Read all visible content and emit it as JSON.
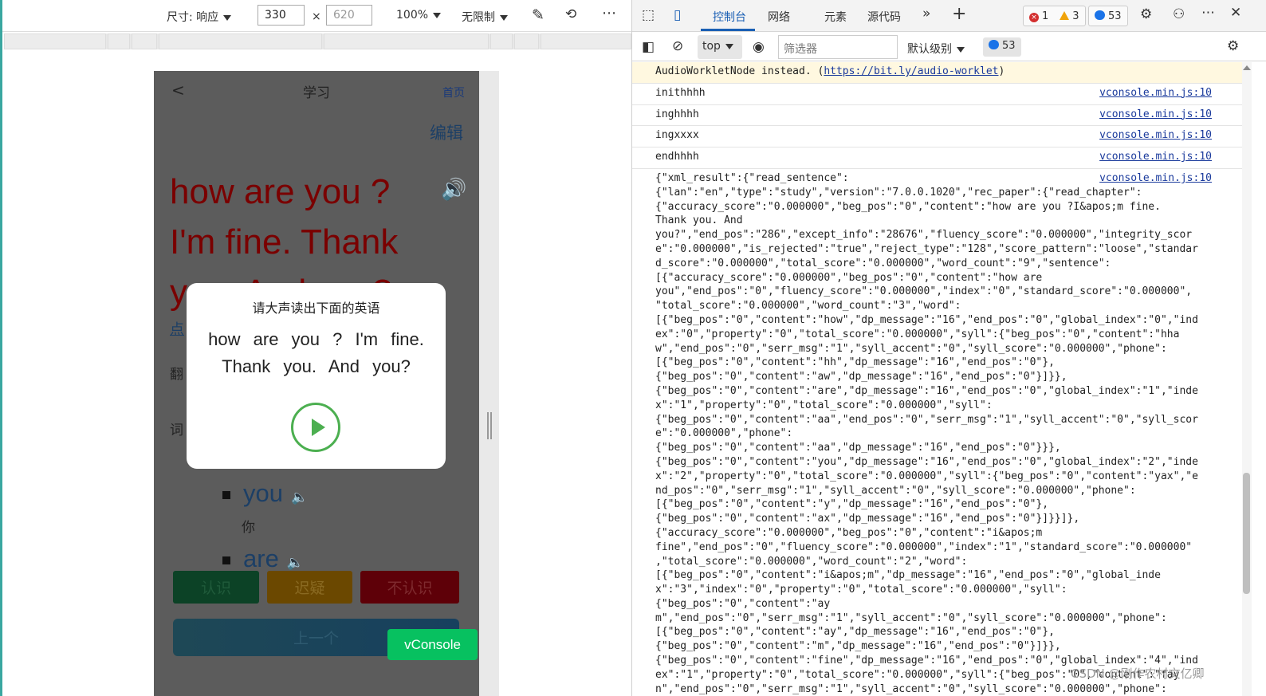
{
  "device_toolbar": {
    "dimensions_label": "尺寸: 响应",
    "width_value": "330",
    "times": "×",
    "height_placeholder": "620",
    "zoom": "100%",
    "throttle": "无限制"
  },
  "app": {
    "back": "<",
    "title": "学习",
    "home_link": "首页",
    "edit_link": "编辑",
    "sentence": "how are you ? I'm fine. Thank you. And you?",
    "hint": "点",
    "translation_label": "翻",
    "words_label": "词",
    "words": [
      {
        "word": "you",
        "meaning": "你"
      },
      {
        "word": "are",
        "meaning": ""
      }
    ],
    "buttons": {
      "know": "认识",
      "doubt": "迟疑",
      "unknown": "不认识",
      "prev": "上一个"
    },
    "vconsole": "vConsole"
  },
  "modal": {
    "title": "请大声读出下面的英语",
    "text": "how are you ? I'm fine. Thank you. And you?"
  },
  "devtools": {
    "tabs": {
      "console": "控制台",
      "network": "网络",
      "elements": "元素",
      "sources": "源代码"
    },
    "counts": {
      "errors": "1",
      "warnings": "3",
      "messages": "53"
    },
    "context": "top",
    "filter_placeholder": "筛选器",
    "level": "默认级别",
    "message_count": "53"
  },
  "console": {
    "warning_text": "AudioWorkletNode instead. (",
    "warning_link": "https://bit.ly/audio-worklet",
    "warning_end": ")",
    "logs": [
      {
        "text": "inithhhh",
        "src": "vconsole.min.js:10"
      },
      {
        "text": "inghhhh",
        "src": "vconsole.min.js:10"
      },
      {
        "text": "ingxxxx",
        "src": "vconsole.min.js:10"
      },
      {
        "text": "endhhhh",
        "src": "vconsole.min.js:10"
      },
      {
        "text": "{\"xml_result\":{\"read_sentence\":\n{\"lan\":\"en\",\"type\":\"study\",\"version\":\"7.0.0.1020\",\"rec_paper\":{\"read_chapter\":\n{\"accuracy_score\":\"0.000000\",\"beg_pos\":\"0\",\"content\":\"how are you ?I&apos;m fine.\nThank you. And\nyou?\",\"end_pos\":\"286\",\"except_info\":\"28676\",\"fluency_score\":\"0.000000\",\"integrity_score\":\"0.000000\",\"is_rejected\":\"true\",\"reject_type\":\"128\",\"score_pattern\":\"loose\",\"standard_score\":\"0.000000\",\"total_score\":\"0.000000\",\"word_count\":\"9\",\"sentence\":\n[{\"accuracy_score\":\"0.000000\",\"beg_pos\":\"0\",\"content\":\"how are\nyou\",\"end_pos\":\"0\",\"fluency_score\":\"0.000000\",\"index\":\"0\",\"standard_score\":\"0.000000\",\n\"total_score\":\"0.000000\",\"word_count\":\"3\",\"word\":\n[{\"beg_pos\":\"0\",\"content\":\"how\",\"dp_message\":\"16\",\"end_pos\":\"0\",\"global_index\":\"0\",\"index\":\"0\",\"property\":\"0\",\"total_score\":\"0.000000\",\"syll\":{\"beg_pos\":\"0\",\"content\":\"hhaw\",\"end_pos\":\"0\",\"serr_msg\":\"1\",\"syll_accent\":\"0\",\"syll_score\":\"0.000000\",\"phone\":\n[{\"beg_pos\":\"0\",\"content\":\"hh\",\"dp_message\":\"16\",\"end_pos\":\"0\"},\n{\"beg_pos\":\"0\",\"content\":\"aw\",\"dp_message\":\"16\",\"end_pos\":\"0\"}]}},\n{\"beg_pos\":\"0\",\"content\":\"are\",\"dp_message\":\"16\",\"end_pos\":\"0\",\"global_index\":\"1\",\"index\":\"1\",\"property\":\"0\",\"total_score\":\"0.000000\",\"syll\":\n{\"beg_pos\":\"0\",\"content\":\"aa\",\"end_pos\":\"0\",\"serr_msg\":\"1\",\"syll_accent\":\"0\",\"syll_score\":\"0.000000\",\"phone\":\n{\"beg_pos\":\"0\",\"content\":\"aa\",\"dp_message\":\"16\",\"end_pos\":\"0\"}}},\n{\"beg_pos\":\"0\",\"content\":\"you\",\"dp_message\":\"16\",\"end_pos\":\"0\",\"global_index\":\"2\",\"index\":\"2\",\"property\":\"0\",\"total_score\":\"0.000000\",\"syll\":{\"beg_pos\":\"0\",\"content\":\"yax\",\"end_pos\":\"0\",\"serr_msg\":\"1\",\"syll_accent\":\"0\",\"syll_score\":\"0.000000\",\"phone\":\n[{\"beg_pos\":\"0\",\"content\":\"y\",\"dp_message\":\"16\",\"end_pos\":\"0\"},\n{\"beg_pos\":\"0\",\"content\":\"ax\",\"dp_message\":\"16\",\"end_pos\":\"0\"}]}}]},\n{\"accuracy_score\":\"0.000000\",\"beg_pos\":\"0\",\"content\":\"i&apos;m\nfine\",\"end_pos\":\"0\",\"fluency_score\":\"0.000000\",\"index\":\"1\",\"standard_score\":\"0.000000\"\n,\"total_score\":\"0.000000\",\"word_count\":\"2\",\"word\":\n[{\"beg_pos\":\"0\",\"content\":\"i&apos;m\",\"dp_message\":\"16\",\"end_pos\":\"0\",\"global_index\":\"3\",\"index\":\"0\",\"property\":\"0\",\"total_score\":\"0.000000\",\"syll\":\n{\"beg_pos\":\"0\",\"content\":\"ay\nm\",\"end_pos\":\"0\",\"serr_msg\":\"1\",\"syll_accent\":\"0\",\"syll_score\":\"0.000000\",\"phone\":\n[{\"beg_pos\":\"0\",\"content\":\"ay\",\"dp_message\":\"16\",\"end_pos\":\"0\"},\n{\"beg_pos\":\"0\",\"content\":\"m\",\"dp_message\":\"16\",\"end_pos\":\"0\"}]}},\n{\"beg_pos\":\"0\",\"content\":\"fine\",\"dp_message\":\"16\",\"end_pos\":\"0\",\"global_index\":\"4\",\"index\":\"1\",\"property\":\"0\",\"total_score\":\"0.000000\",\"syll\":{\"beg_pos\":\"0\",\"content\":\"fay\nn\",\"end_pos\":\"0\",\"serr_msg\":\"1\",\"syll_accent\":\"0\",\"syll_score\":\"0.000000\",\"phone\":",
        "src": "vconsole.min.js:10"
      }
    ]
  },
  "watermark": "CSDN @刚作农村文亿卿"
}
